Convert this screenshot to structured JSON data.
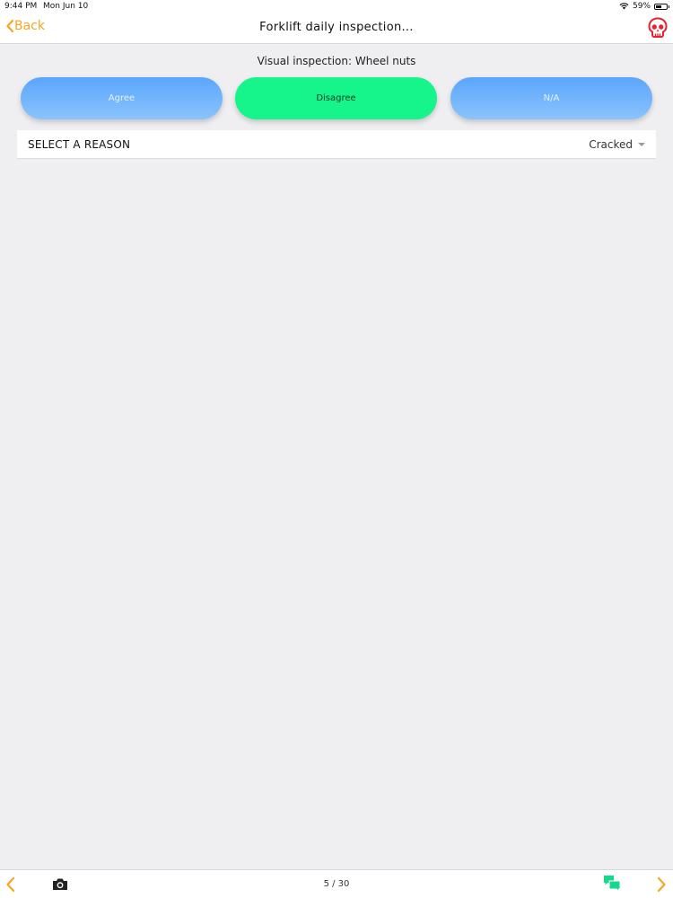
{
  "status_bar": {
    "time": "9:44 PM",
    "date": "Mon Jun 10",
    "battery": "59%",
    "battery_level": 0.59,
    "wifi_icon": "wifi-icon"
  },
  "nav": {
    "back_label": "Back",
    "title": "Forklift daily inspection...",
    "danger_icon": "skull-icon"
  },
  "question": {
    "text": "Visual inspection: Wheel nuts",
    "choices": [
      {
        "label": "Agree",
        "selected": false
      },
      {
        "label": "Disagree",
        "selected": true
      },
      {
        "label": "N/A",
        "selected": false
      }
    ]
  },
  "reason": {
    "label": "SELECT A REASON",
    "value": "Cracked"
  },
  "footer": {
    "page": "5 / 30"
  },
  "colors": {
    "accent": "#f5a623",
    "selected_choice": "#15f58c",
    "unselected_choice": "#6fb3fc",
    "danger": "#e8232e",
    "chat": "#15d98a"
  }
}
